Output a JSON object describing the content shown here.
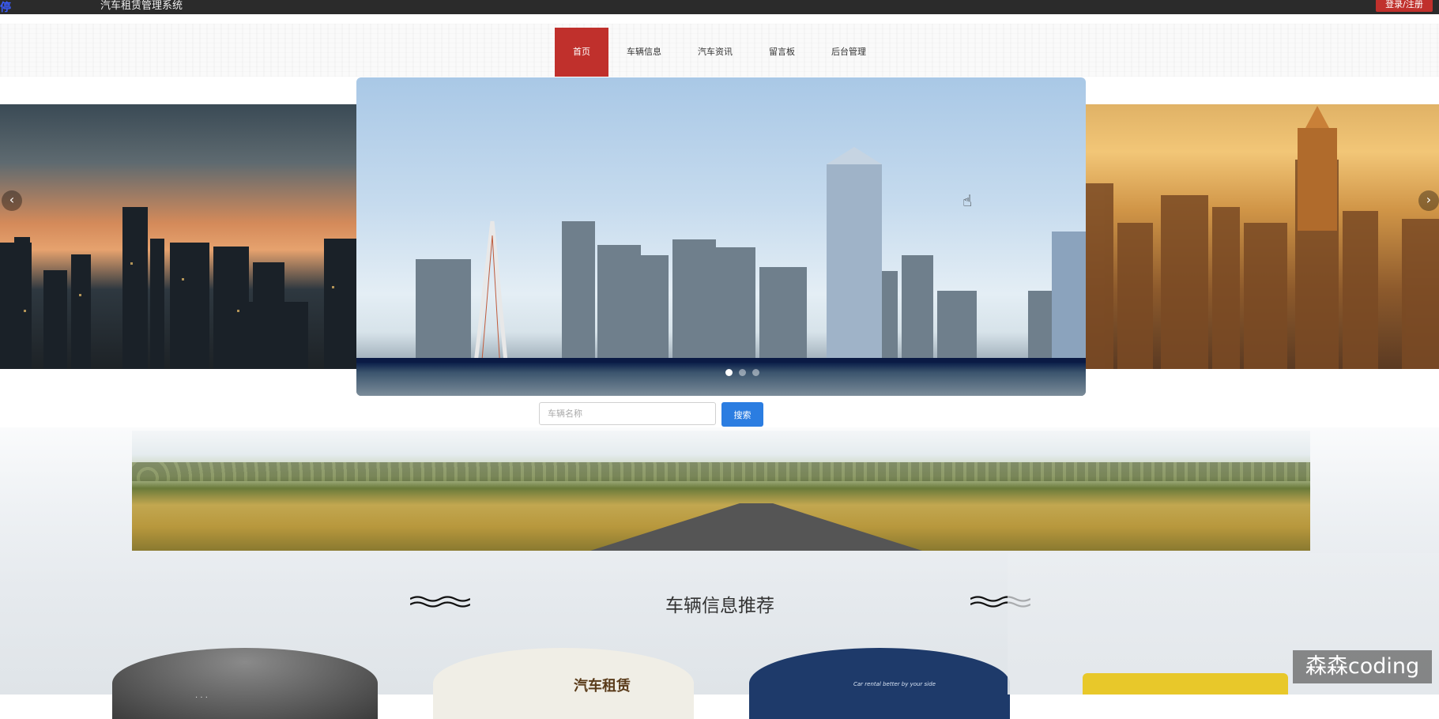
{
  "topbar": {
    "corner_glyph": "停",
    "system_title": "汽车租赁管理系统",
    "login_label": "登录/注册"
  },
  "nav": {
    "items": [
      {
        "label": "首页",
        "active": true
      },
      {
        "label": "车辆信息",
        "active": false
      },
      {
        "label": "汽车资讯",
        "active": false
      },
      {
        "label": "留言板",
        "active": false
      },
      {
        "label": "后台管理",
        "active": false
      }
    ]
  },
  "carousel": {
    "prev_icon": "chevron-left-icon",
    "next_icon": "chevron-right-icon",
    "prev_glyph": "‹",
    "next_glyph": "›",
    "slide_count": 3,
    "active_slide": 1
  },
  "search": {
    "placeholder": "车辆名称",
    "value": "",
    "button_label": "搜索"
  },
  "section": {
    "title": "车辆信息推荐"
  },
  "cards": [
    {
      "caption": "·  ·  ·"
    },
    {
      "caption": "汽车租赁"
    },
    {
      "caption": "Car rental better by your side"
    }
  ],
  "watermark": "森森coding",
  "colors": {
    "accent_red": "#c0302c",
    "button_blue": "#2b7de1",
    "topbar_dark": "#2b2b2b"
  }
}
